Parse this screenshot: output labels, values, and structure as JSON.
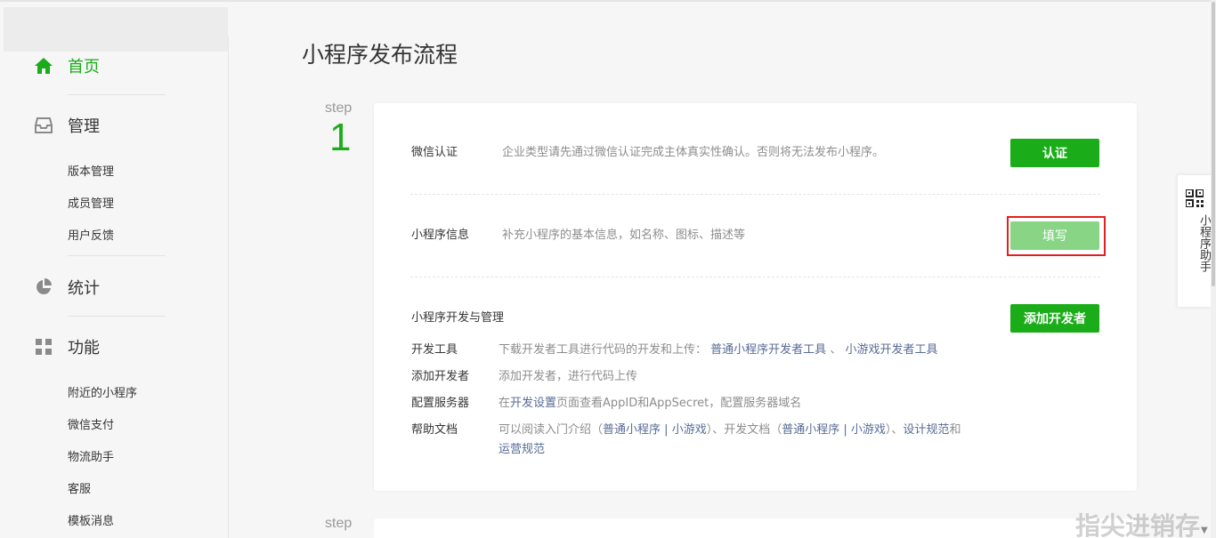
{
  "sidebar": {
    "home": {
      "label": "首页",
      "icon": "home-icon",
      "color": "#1aad19"
    },
    "manage": {
      "label": "管理",
      "icon": "inbox-icon",
      "items": [
        "版本管理",
        "成员管理",
        "用户反馈"
      ]
    },
    "stats": {
      "label": "统计",
      "icon": "pie-chart-icon"
    },
    "features": {
      "label": "功能",
      "icon": "grid-icon",
      "items": [
        "附近的小程序",
        "微信支付",
        "物流助手",
        "客服",
        "模板消息"
      ]
    }
  },
  "main": {
    "title": "小程序发布流程",
    "step_word": "step",
    "step1_number": "1",
    "step2_word": "step",
    "sections": {
      "wechat_auth": {
        "title": "微信认证",
        "desc": "企业类型请先通过微信认证完成主体真实性确认。否则将无法发布小程序。",
        "button": "认证"
      },
      "info": {
        "title": "小程序信息",
        "desc": "补充小程序的基本信息，如名称、图标、描述等",
        "button": "填写"
      },
      "dev": {
        "title": "小程序开发与管理",
        "button": "添加开发者",
        "rows": {
          "tools": {
            "label": "开发工具",
            "text": "下载开发者工具进行代码的开发和上传：",
            "link1": "普通小程序开发者工具",
            "sep": "、",
            "link2": "小游戏开发者工具"
          },
          "add_dev": {
            "label": "添加开发者",
            "text": "添加开发者，进行代码上传"
          },
          "server": {
            "label": "配置服务器",
            "pre": "在",
            "link": "开发设置",
            "post": "页面查看AppID和AppSecret，配置服务器域名"
          },
          "docs": {
            "label": "帮助文档",
            "t1": "可以阅读入门介绍（",
            "l1": "普通小程序",
            "bar1": " | ",
            "l2": "小游戏",
            "t2": "）、开发文档（",
            "l3": "普通小程序",
            "bar2": " | ",
            "l4": "小游戏",
            "t3": "）、",
            "l5": "设计规范",
            "t4": "和",
            "l6": "运营规范"
          }
        }
      }
    }
  },
  "helper": {
    "label": "小程序助手",
    "icon": "qr-code-icon"
  },
  "watermark": "指尖进销存",
  "colors": {
    "accent": "#1aad19",
    "accent_disabled": "#88d685",
    "link": "#576b95",
    "highlight": "#e02020"
  }
}
